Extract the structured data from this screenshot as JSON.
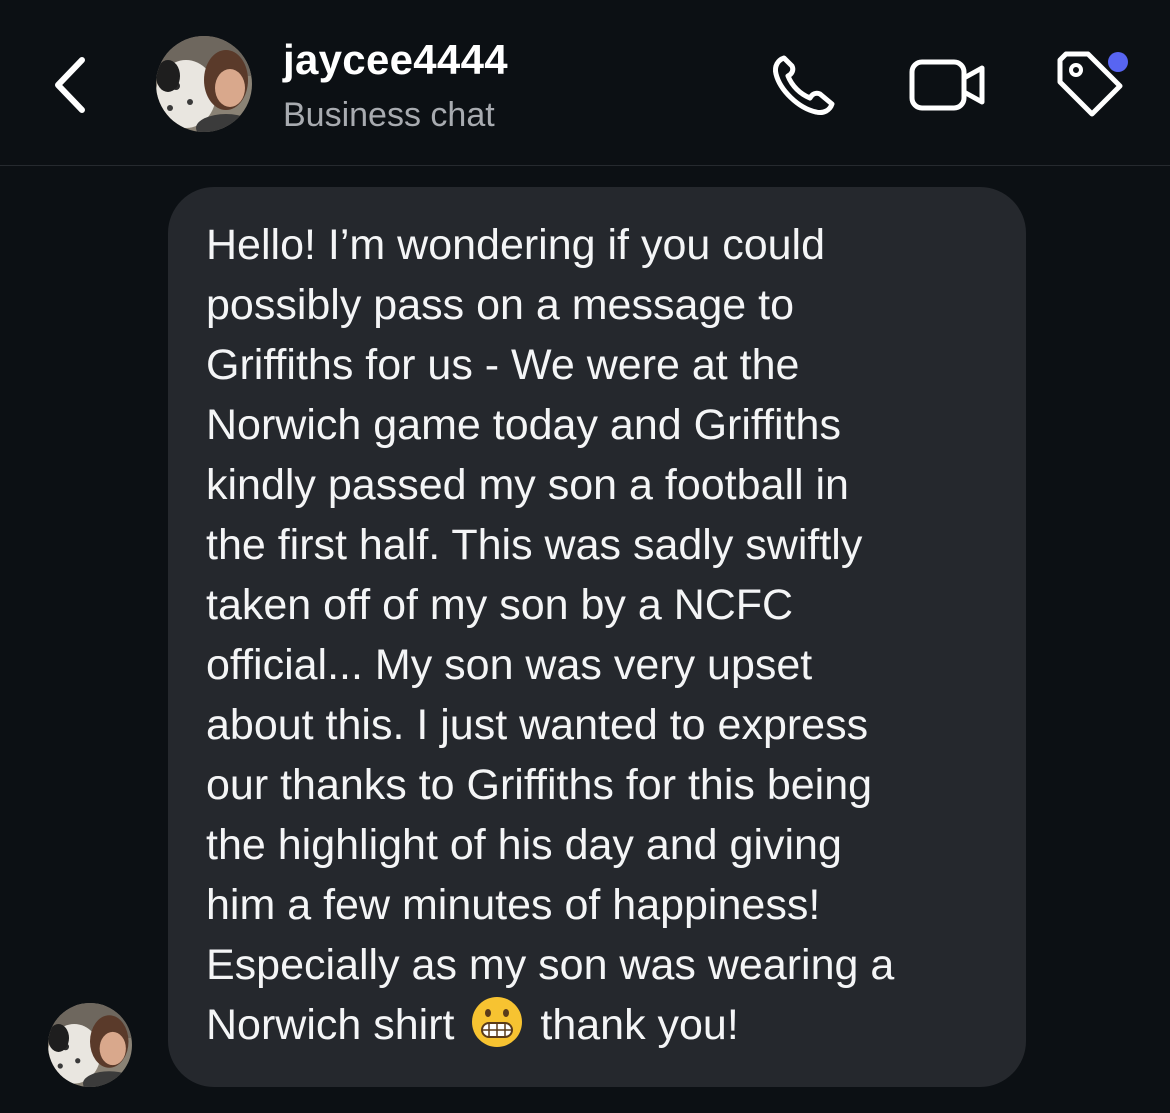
{
  "header": {
    "username": "jaycee4444",
    "subtitle": "Business chat",
    "icons": [
      "chevron-left-icon",
      "phone-icon",
      "video-camera-icon",
      "tag-icon"
    ],
    "notification_dot_color": "#5865f2"
  },
  "message": {
    "text_before_emoji": "Hello! I’m wondering if you could\npossibly pass on a message to\nGriffiths for us - We were at the\nNorwich game today and Griffiths\nkindly passed my son a football in\nthe first half. This was sadly swiftly\ntaken off of my son by a NCFC\nofficial... My son was very upset\nabout this. I just wanted to express\nour thanks to Griffiths for this being\nthe highlight of his day and giving\nhim a few minutes of happiness!\nEspecially as my son was wearing a\nNorwich shirt ",
    "emoji": "grimacing-face",
    "text_after_emoji": " thank you!"
  },
  "colors": {
    "background": "#0c1014",
    "bubble": "#25282d",
    "subtitle": "#a8abb0"
  }
}
